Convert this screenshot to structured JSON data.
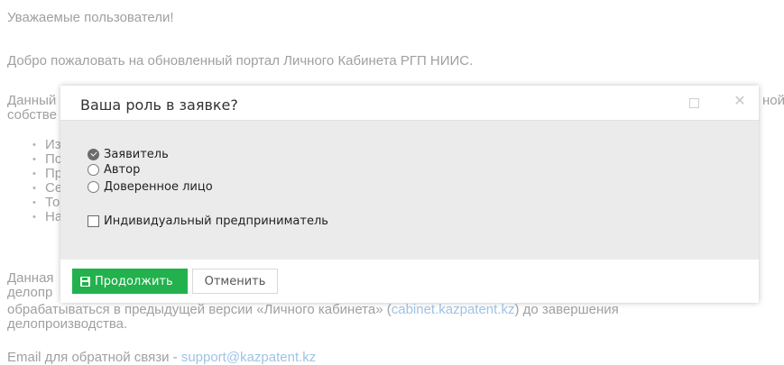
{
  "background": {
    "greeting": "Уважаемые пользователи!",
    "welcome": "Добро пожаловать на обновленный портал Личного Кабинета РГП НИИС.",
    "intro_start": "Данный",
    "intro_end": "ной",
    "intro_line2": "собстве",
    "list_fragments": [
      "Из",
      "По",
      "Пр",
      "Се",
      "То",
      "На"
    ],
    "note_start": "Данная",
    "note_line2": "делопр",
    "note_line3_before": "обрабатываться в предыдущей версии «Личного кабинета» (",
    "note_link": "cabinet.kazpatent.kz",
    "note_line3_after": ") до завершения",
    "note_line4": "делопроизводства.",
    "email_label": "Email для обратной связи - ",
    "email_link": "support@kazpatent.kz"
  },
  "modal": {
    "title": "Ваша роль в заявке?",
    "roles": [
      {
        "label": "Заявитель",
        "checked": true
      },
      {
        "label": "Автор",
        "checked": false
      },
      {
        "label": "Доверенное лицо",
        "checked": false
      }
    ],
    "entrepreneur_label": "Индивидуальный предприниматель",
    "entrepreneur_checked": false,
    "continue_label": "Продолжить",
    "cancel_label": "Отменить"
  },
  "colors": {
    "primary_button": "#22b14c",
    "link": "#9fc3e4",
    "body_bg": "#ebebeb"
  },
  "icons": [
    "save-icon",
    "maximize-icon",
    "close-icon"
  ]
}
